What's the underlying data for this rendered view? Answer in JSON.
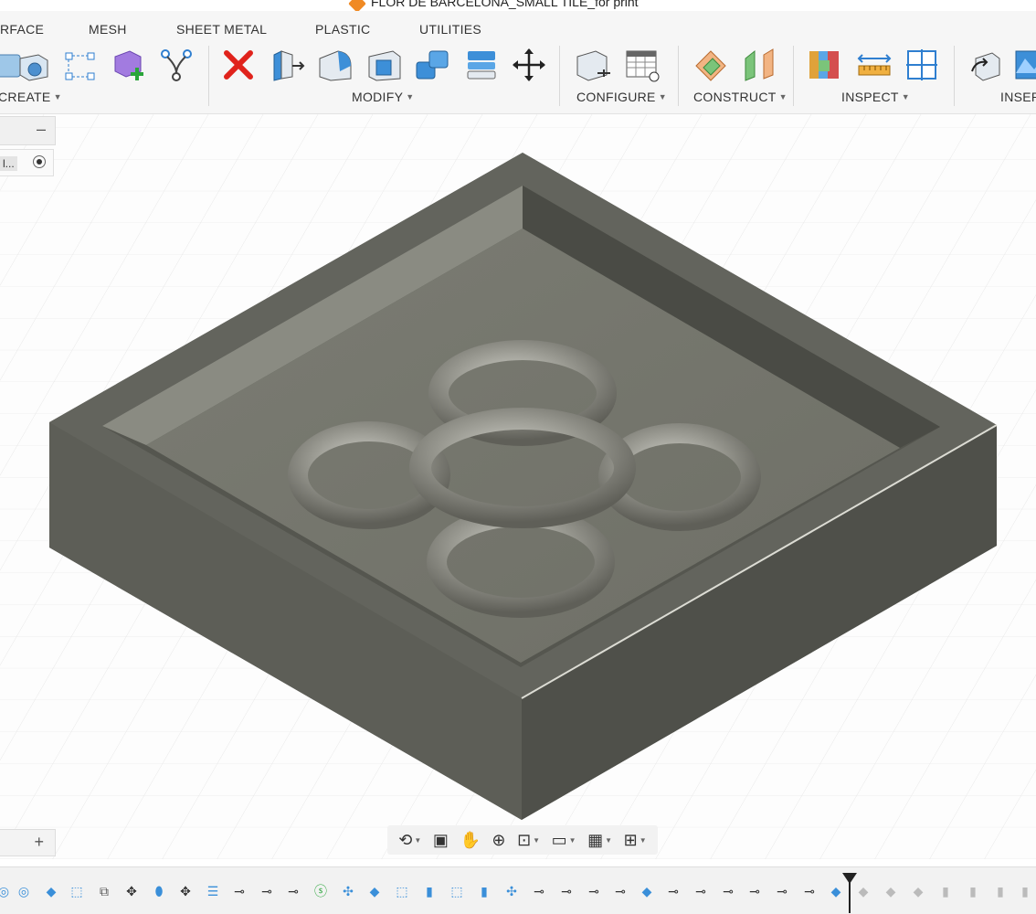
{
  "document": {
    "title": "FLOR DE BARCELONA_SMALL TILE_for print"
  },
  "tabs": [
    {
      "label": "RFACE"
    },
    {
      "label": "MESH"
    },
    {
      "label": "SHEET METAL"
    },
    {
      "label": "PLASTIC"
    },
    {
      "label": "UTILITIES"
    }
  ],
  "groups": {
    "create": "CREATE",
    "modify": "MODIFY",
    "configure": "CONFIGURE",
    "construct": "CONSTRUCT",
    "inspect": "INSPECT",
    "insert": "INSER"
  },
  "tools": [
    {
      "icon": "create-form-icon"
    },
    {
      "icon": "sketch-point-icon"
    },
    {
      "icon": "derive-icon"
    },
    {
      "icon": "fork-icon"
    },
    {
      "icon": "delete-icon"
    },
    {
      "icon": "press-pull-icon"
    },
    {
      "icon": "fillet-icon"
    },
    {
      "icon": "shell-icon"
    },
    {
      "icon": "combine-icon"
    },
    {
      "icon": "split-face-icon"
    },
    {
      "icon": "move-icon"
    },
    {
      "icon": "parameters-icon"
    },
    {
      "icon": "configure-table-icon"
    },
    {
      "icon": "offset-plane-icon"
    },
    {
      "icon": "midplane-icon"
    },
    {
      "icon": "interference-icon"
    },
    {
      "icon": "measure-icon"
    },
    {
      "icon": "section-analysis-icon"
    },
    {
      "icon": "insert-derive-icon"
    },
    {
      "icon": "decal-icon"
    }
  ],
  "browser": {
    "row_label": "l..."
  },
  "colors": {
    "accent": "#1f8fd4",
    "delete": "#e0231c",
    "model": "#6a6b63"
  },
  "timeline": {
    "marker_position": "end"
  }
}
